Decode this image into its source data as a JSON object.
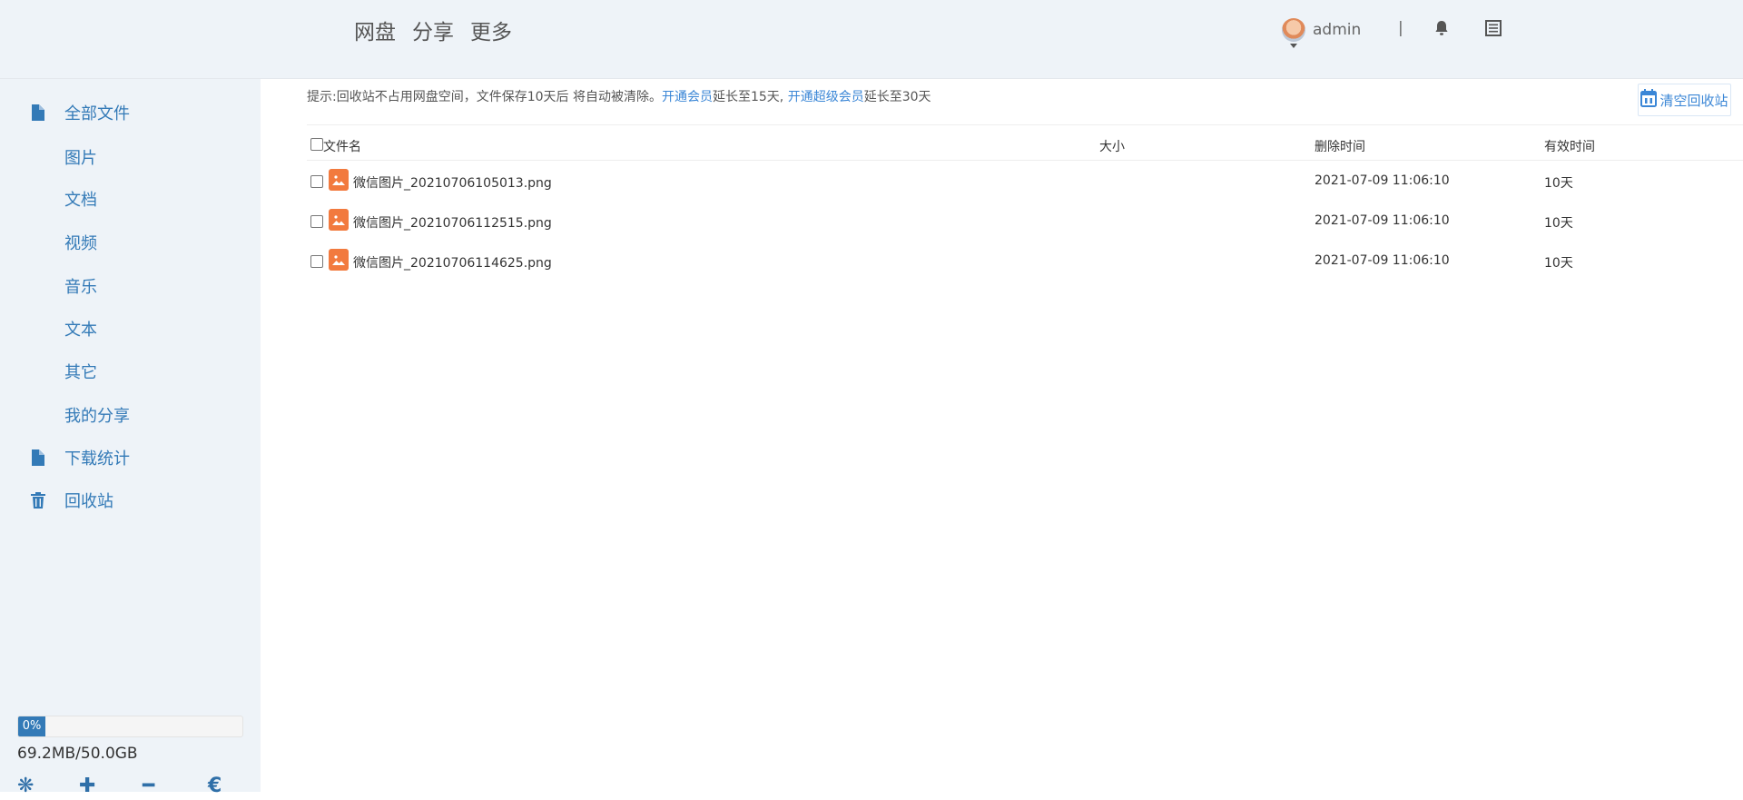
{
  "header": {
    "nav": [
      "网盘",
      "分享",
      "更多"
    ],
    "user": {
      "name": "admin"
    },
    "separator": "|",
    "icons": [
      "bell-icon",
      "list-icon"
    ]
  },
  "sidebar": {
    "items": [
      {
        "label": "全部文件",
        "icon": "file-icon"
      },
      {
        "label": "图片",
        "icon": ""
      },
      {
        "label": "文档",
        "icon": ""
      },
      {
        "label": "视频",
        "icon": ""
      },
      {
        "label": "音乐",
        "icon": ""
      },
      {
        "label": "文本",
        "icon": ""
      },
      {
        "label": "其它",
        "icon": ""
      },
      {
        "label": "我的分享",
        "icon": ""
      },
      {
        "label": "下载统计",
        "icon": "file-icon"
      },
      {
        "label": "回收站",
        "icon": "trash-icon"
      }
    ],
    "storage": {
      "percent_label": "0%",
      "percent": 0,
      "usage": "69.2MB/50.0GB"
    },
    "tools": [
      "❋",
      "✚",
      "━",
      "€"
    ]
  },
  "main": {
    "tip": {
      "prefix": "提示:回收站不占用网盘空间，文件保存10天后 将自动被清除。",
      "link1": "开通会员",
      "mid": "延长至15天,",
      "link2": "开通超级会员",
      "suffix": "延长至30天"
    },
    "clear_button": "清空回收站",
    "columns": {
      "name": "文件名",
      "size": "大小",
      "deleted": "删除时间",
      "valid": "有效时间"
    },
    "rows": [
      {
        "name": "微信图片_20210706105013.png",
        "size": "",
        "deleted": "2021-07-09 11:06:10",
        "valid": "10天"
      },
      {
        "name": "微信图片_20210706112515.png",
        "size": "",
        "deleted": "2021-07-09 11:06:10",
        "valid": "10天"
      },
      {
        "name": "微信图片_20210706114625.png",
        "size": "",
        "deleted": "2021-07-09 11:06:10",
        "valid": "10天"
      }
    ]
  },
  "colors": {
    "accent": "#337ab7",
    "link": "#3a86d6",
    "file_icon": "#f27a3e",
    "header_bg": "#eef3f8"
  }
}
